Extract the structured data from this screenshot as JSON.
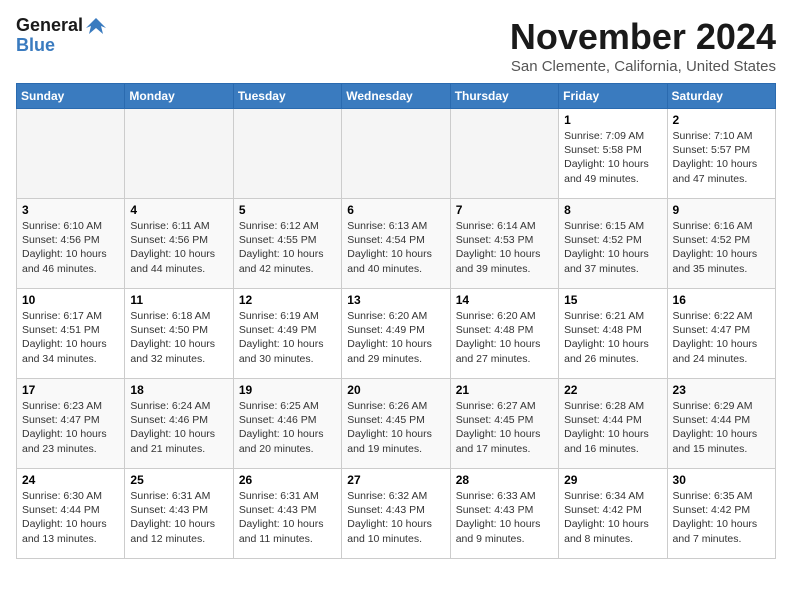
{
  "header": {
    "logo_line1": "General",
    "logo_line2": "Blue",
    "month": "November 2024",
    "location": "San Clemente, California, United States"
  },
  "weekdays": [
    "Sunday",
    "Monday",
    "Tuesday",
    "Wednesday",
    "Thursday",
    "Friday",
    "Saturday"
  ],
  "weeks": [
    [
      {
        "day": "",
        "info": ""
      },
      {
        "day": "",
        "info": ""
      },
      {
        "day": "",
        "info": ""
      },
      {
        "day": "",
        "info": ""
      },
      {
        "day": "",
        "info": ""
      },
      {
        "day": "1",
        "info": "Sunrise: 7:09 AM\nSunset: 5:58 PM\nDaylight: 10 hours\nand 49 minutes."
      },
      {
        "day": "2",
        "info": "Sunrise: 7:10 AM\nSunset: 5:57 PM\nDaylight: 10 hours\nand 47 minutes."
      }
    ],
    [
      {
        "day": "3",
        "info": "Sunrise: 6:10 AM\nSunset: 4:56 PM\nDaylight: 10 hours\nand 46 minutes."
      },
      {
        "day": "4",
        "info": "Sunrise: 6:11 AM\nSunset: 4:56 PM\nDaylight: 10 hours\nand 44 minutes."
      },
      {
        "day": "5",
        "info": "Sunrise: 6:12 AM\nSunset: 4:55 PM\nDaylight: 10 hours\nand 42 minutes."
      },
      {
        "day": "6",
        "info": "Sunrise: 6:13 AM\nSunset: 4:54 PM\nDaylight: 10 hours\nand 40 minutes."
      },
      {
        "day": "7",
        "info": "Sunrise: 6:14 AM\nSunset: 4:53 PM\nDaylight: 10 hours\nand 39 minutes."
      },
      {
        "day": "8",
        "info": "Sunrise: 6:15 AM\nSunset: 4:52 PM\nDaylight: 10 hours\nand 37 minutes."
      },
      {
        "day": "9",
        "info": "Sunrise: 6:16 AM\nSunset: 4:52 PM\nDaylight: 10 hours\nand 35 minutes."
      }
    ],
    [
      {
        "day": "10",
        "info": "Sunrise: 6:17 AM\nSunset: 4:51 PM\nDaylight: 10 hours\nand 34 minutes."
      },
      {
        "day": "11",
        "info": "Sunrise: 6:18 AM\nSunset: 4:50 PM\nDaylight: 10 hours\nand 32 minutes."
      },
      {
        "day": "12",
        "info": "Sunrise: 6:19 AM\nSunset: 4:49 PM\nDaylight: 10 hours\nand 30 minutes."
      },
      {
        "day": "13",
        "info": "Sunrise: 6:20 AM\nSunset: 4:49 PM\nDaylight: 10 hours\nand 29 minutes."
      },
      {
        "day": "14",
        "info": "Sunrise: 6:20 AM\nSunset: 4:48 PM\nDaylight: 10 hours\nand 27 minutes."
      },
      {
        "day": "15",
        "info": "Sunrise: 6:21 AM\nSunset: 4:48 PM\nDaylight: 10 hours\nand 26 minutes."
      },
      {
        "day": "16",
        "info": "Sunrise: 6:22 AM\nSunset: 4:47 PM\nDaylight: 10 hours\nand 24 minutes."
      }
    ],
    [
      {
        "day": "17",
        "info": "Sunrise: 6:23 AM\nSunset: 4:47 PM\nDaylight: 10 hours\nand 23 minutes."
      },
      {
        "day": "18",
        "info": "Sunrise: 6:24 AM\nSunset: 4:46 PM\nDaylight: 10 hours\nand 21 minutes."
      },
      {
        "day": "19",
        "info": "Sunrise: 6:25 AM\nSunset: 4:46 PM\nDaylight: 10 hours\nand 20 minutes."
      },
      {
        "day": "20",
        "info": "Sunrise: 6:26 AM\nSunset: 4:45 PM\nDaylight: 10 hours\nand 19 minutes."
      },
      {
        "day": "21",
        "info": "Sunrise: 6:27 AM\nSunset: 4:45 PM\nDaylight: 10 hours\nand 17 minutes."
      },
      {
        "day": "22",
        "info": "Sunrise: 6:28 AM\nSunset: 4:44 PM\nDaylight: 10 hours\nand 16 minutes."
      },
      {
        "day": "23",
        "info": "Sunrise: 6:29 AM\nSunset: 4:44 PM\nDaylight: 10 hours\nand 15 minutes."
      }
    ],
    [
      {
        "day": "24",
        "info": "Sunrise: 6:30 AM\nSunset: 4:44 PM\nDaylight: 10 hours\nand 13 minutes."
      },
      {
        "day": "25",
        "info": "Sunrise: 6:31 AM\nSunset: 4:43 PM\nDaylight: 10 hours\nand 12 minutes."
      },
      {
        "day": "26",
        "info": "Sunrise: 6:31 AM\nSunset: 4:43 PM\nDaylight: 10 hours\nand 11 minutes."
      },
      {
        "day": "27",
        "info": "Sunrise: 6:32 AM\nSunset: 4:43 PM\nDaylight: 10 hours\nand 10 minutes."
      },
      {
        "day": "28",
        "info": "Sunrise: 6:33 AM\nSunset: 4:43 PM\nDaylight: 10 hours\nand 9 minutes."
      },
      {
        "day": "29",
        "info": "Sunrise: 6:34 AM\nSunset: 4:42 PM\nDaylight: 10 hours\nand 8 minutes."
      },
      {
        "day": "30",
        "info": "Sunrise: 6:35 AM\nSunset: 4:42 PM\nDaylight: 10 hours\nand 7 minutes."
      }
    ]
  ]
}
